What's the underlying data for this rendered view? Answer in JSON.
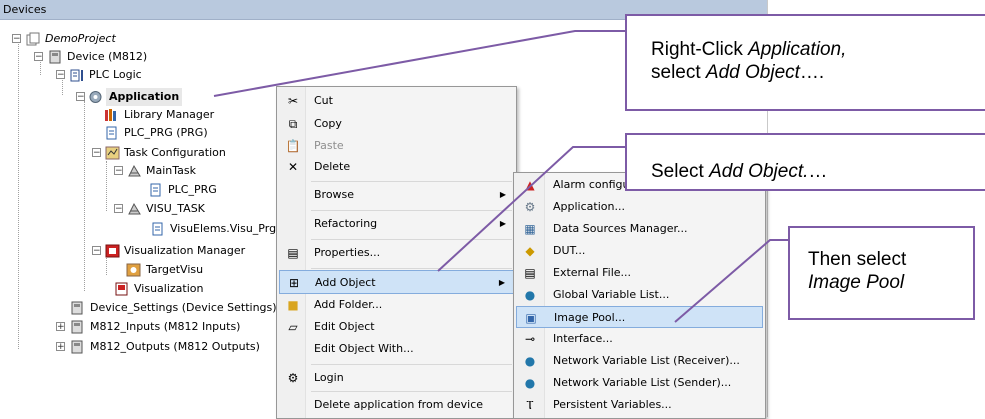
{
  "pane": {
    "title": "Devices"
  },
  "tree": {
    "project": "DemoProject",
    "device": "Device (M812)",
    "plc_logic": "PLC Logic",
    "application": "Application",
    "library_manager": "Library Manager",
    "plc_prg": "PLC_PRG (PRG)",
    "task_configuration": "Task Configuration",
    "main_task": "MainTask",
    "main_task_plc_prg": "PLC_PRG",
    "visu_task": "VISU_TASK",
    "visu_prg": "VisuElems.Visu_Prg",
    "visualization_manager": "Visualization Manager",
    "target_visu": "TargetVisu",
    "visualization": "Visualization",
    "device_settings": "Device_Settings (Device Settings)",
    "inputs": "M812_Inputs (M812 Inputs)",
    "outputs": "M812_Outputs (M812 Outputs)"
  },
  "context_menu": {
    "cut": "Cut",
    "copy": "Copy",
    "paste": "Paste",
    "delete": "Delete",
    "browse": "Browse",
    "refactoring": "Refactoring",
    "properties": "Properties...",
    "add_object": "Add Object",
    "add_folder": "Add Folder...",
    "edit_object": "Edit Object",
    "edit_object_with": "Edit Object With...",
    "login": "Login",
    "delete_application": "Delete application from device"
  },
  "submenu": {
    "alarm": "Alarm configu",
    "application": "Application...",
    "data_sources": "Data Sources Manager...",
    "dut": "DUT...",
    "external_file": "External File...",
    "gvl": "Global Variable List...",
    "image_pool": "Image Pool...",
    "interface": "Interface...",
    "nvl_receiver": "Network Variable List (Receiver)...",
    "nvl_sender": "Network Variable List (Sender)...",
    "persistent": "Persistent Variables..."
  },
  "callouts": {
    "c1_a": "Right-Click ",
    "c1_b": "Application,",
    "c1_c": "select ",
    "c1_d": "Add Object",
    "c1_e": "….",
    "c2_a": "Select ",
    "c2_b": "Add Object.",
    "c2_c": "…",
    "c3_a": "Then select",
    "c3_b": "Image Pool"
  },
  "colors": {
    "callout_border": "#7d5ba6",
    "menu_highlight": "#cfe3f7",
    "header_bg": "#b9c9de"
  }
}
